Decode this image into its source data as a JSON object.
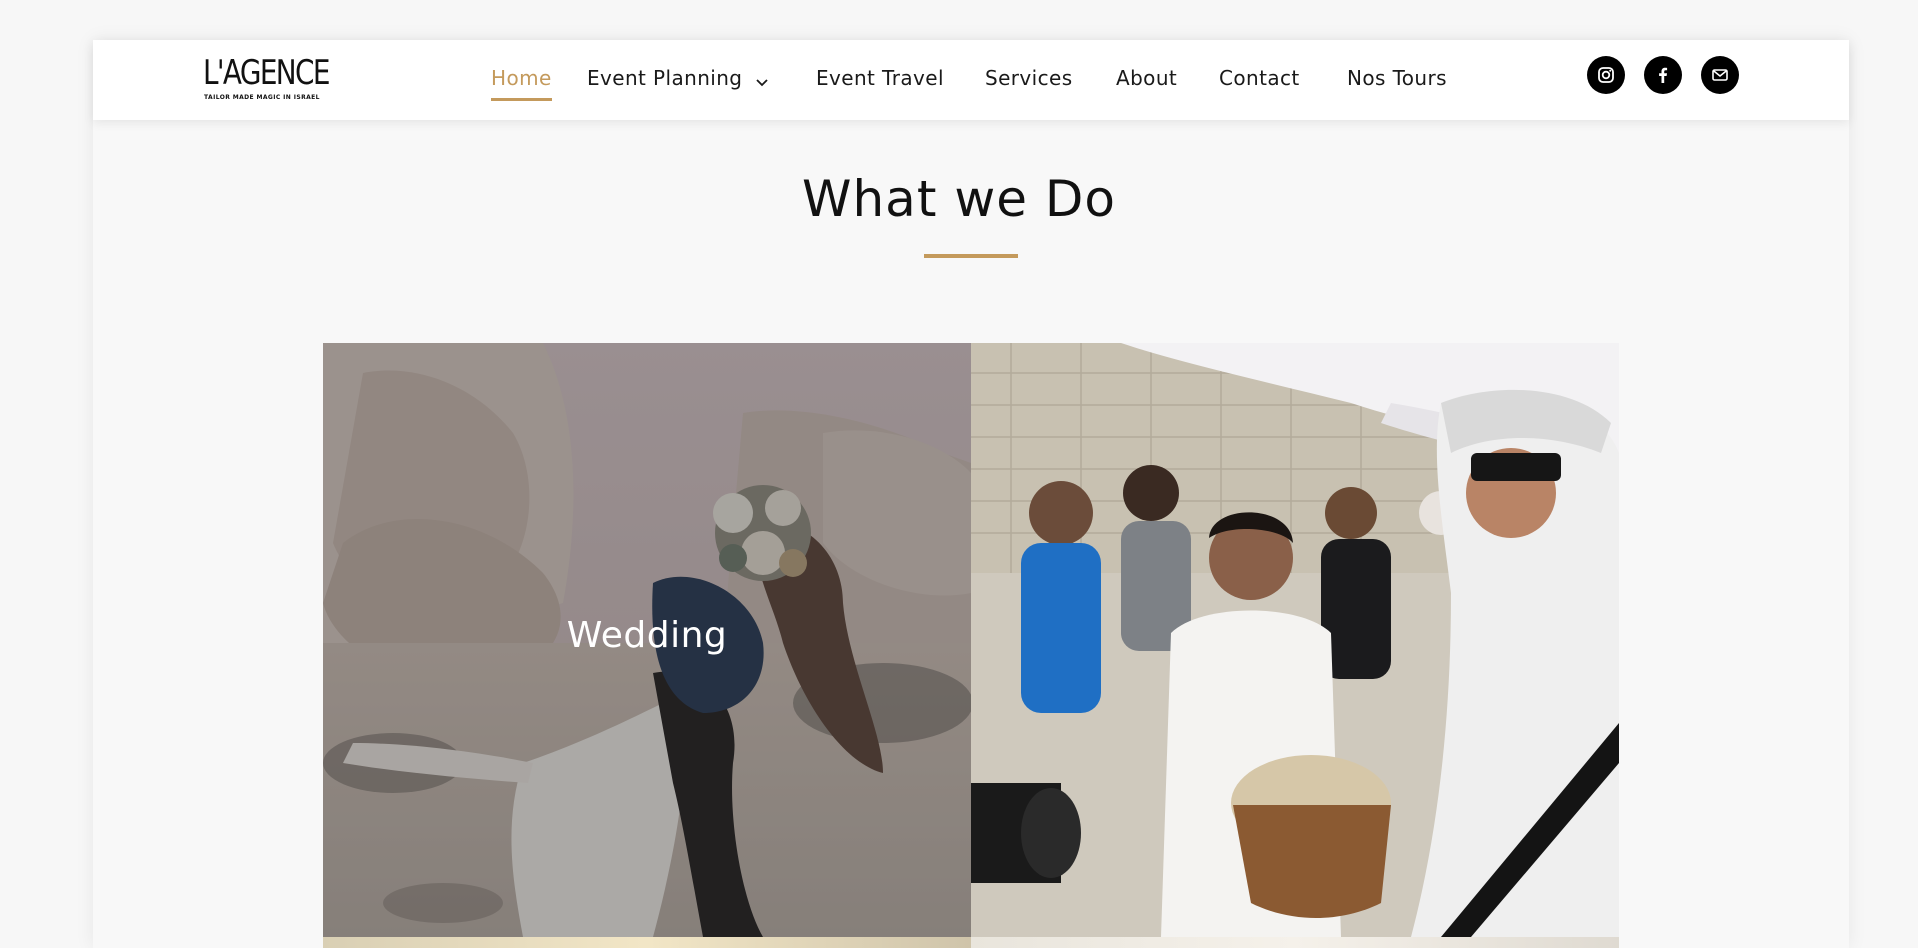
{
  "brand": {
    "name": "L'AGENCE",
    "tagline": "TAILOR MADE MAGIC IN ISRAEL",
    "accent": "#c49a5c"
  },
  "nav": {
    "items": [
      {
        "label": "Home",
        "active": true
      },
      {
        "label": "Event Planning",
        "dropdown": true
      },
      {
        "label": "Event Travel"
      },
      {
        "label": "Services"
      },
      {
        "label": "About"
      },
      {
        "label": "Contact"
      },
      {
        "label": "Nos Tours"
      }
    ]
  },
  "social": [
    {
      "icon": "instagram-icon"
    },
    {
      "icon": "facebook-icon"
    },
    {
      "icon": "mail-icon"
    }
  ],
  "section": {
    "title": "What we Do"
  },
  "tiles": [
    {
      "label": "Wedding",
      "image": "couple-kissing-in-desert-photo"
    },
    {
      "label": "",
      "image": "bar-mitzvah-drum-celebration-photo"
    }
  ]
}
